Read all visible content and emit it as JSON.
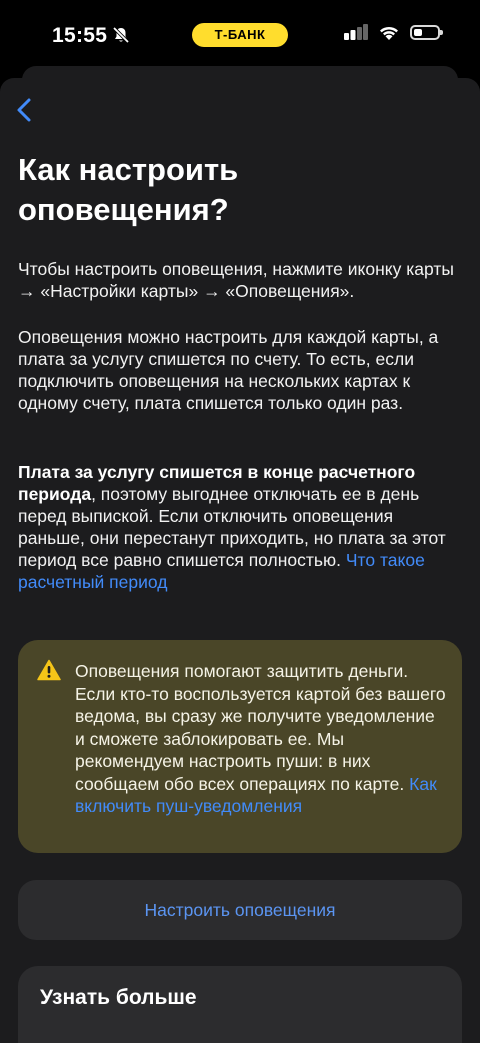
{
  "status_bar": {
    "time": "15:55",
    "bank_badge": "Т-БАНК",
    "icons": [
      "bell-slash-icon",
      "cellular-signal-icon",
      "wifi-icon",
      "battery-icon"
    ]
  },
  "nav": {
    "back_icon": "chevron-left-icon"
  },
  "page": {
    "title": "Как настроить оповещения?",
    "paragraph1": "Чтобы настроить оповещения, нажмите иконку карты → «Настройки карты» → «Оповещения».",
    "paragraph2": "Оповещения можно настроить для каждой карты, а плата за услугу спишется по счету. То есть, если подключить оповещения на нескольких картах к одному счету, плата спишется только один раз.",
    "paragraph3_bold": "Плата за услугу спишется в конце расчетного периода",
    "paragraph3_text": ", поэтому выгоднее отключать ее в день перед выпиской. Если отключить оповещения раньше, они перестанут приходить, но плата за этот период все равно спишется полностью.",
    "paragraph3_link": "Что такое расчетный период"
  },
  "warning": {
    "icon": "warning-triangle-icon",
    "text": "Оповещения помогают защитить деньги. Если кто-то воспользуется картой без вашего ведома, вы сразу же получите уведомление и сможете заблокировать ее. Мы рекомендуем настроить пуши: в них сообщаем обо всех операциях по карте.",
    "link": "Как включить пуш-уведомления"
  },
  "action": {
    "setup_label": "Настроить оповещения"
  },
  "more": {
    "title": "Узнать больше"
  },
  "colors": {
    "background": "#000000",
    "sheet": "#1c1c1e",
    "card": "#2c2c2e",
    "warning_card": "#4a4628",
    "link": "#428bf9",
    "bank_yellow": "#ffdd2d",
    "warning_icon": "#f5c518"
  }
}
